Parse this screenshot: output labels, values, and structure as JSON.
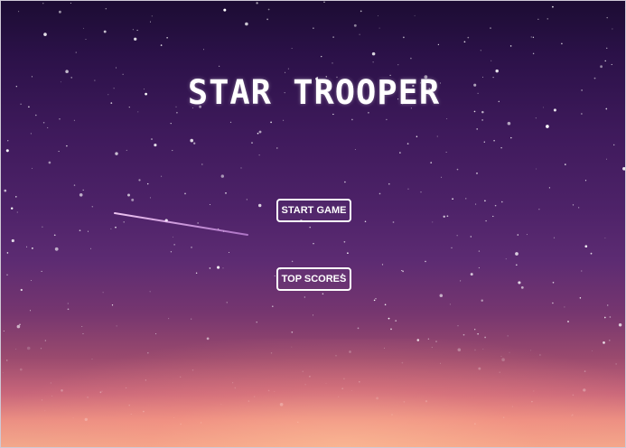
{
  "game": {
    "title": "STAR TROOPER"
  },
  "menu": {
    "start_label": "START GAME",
    "scores_label": "TOP SCORES"
  },
  "colors": {
    "text": "#ffffff",
    "sky_top": "#1c0c33",
    "sky_mid": "#4d2268",
    "horizon": "#f2a98c"
  }
}
